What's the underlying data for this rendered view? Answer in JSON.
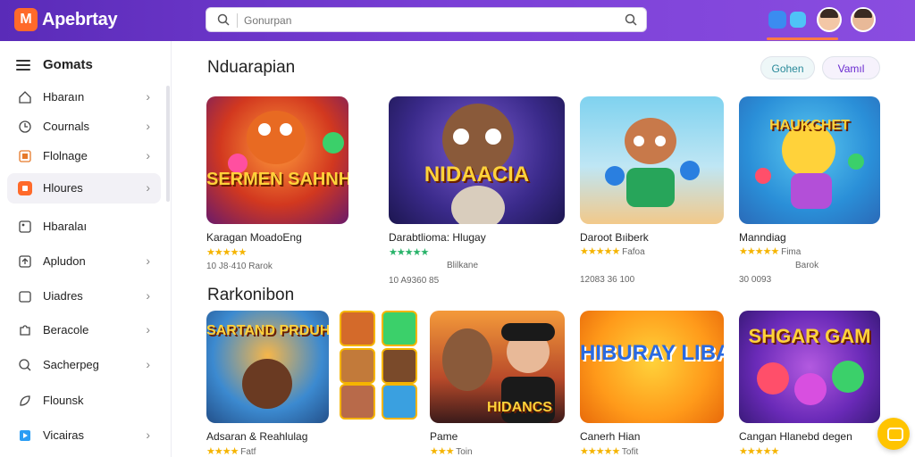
{
  "app": {
    "logo_letter": "M",
    "name": "Apebrtay"
  },
  "search": {
    "placeholder": "Gonurpan"
  },
  "sidebar": {
    "title": "Gomats",
    "items": [
      {
        "label": "Hbaraın",
        "icon": "home-icon"
      },
      {
        "label": "Cournals",
        "icon": "clock-icon"
      },
      {
        "label": "Flolnage",
        "icon": "grid-icon"
      },
      {
        "label": "Hloures",
        "icon": "star-icon",
        "active": true
      },
      {
        "label": "Hbaralaı",
        "icon": "image-icon"
      },
      {
        "label": "Apludon",
        "icon": "upload-icon"
      },
      {
        "label": "Uiadres",
        "icon": "folder-icon"
      },
      {
        "label": "Beracole",
        "icon": "puzzle-icon"
      },
      {
        "label": "Sacherpeg",
        "icon": "search-icon"
      },
      {
        "label": "Flounsk",
        "icon": "bookmark-icon"
      },
      {
        "label": "Vicairas",
        "icon": "video-icon"
      }
    ]
  },
  "main": {
    "section1_title": "Nduarapian",
    "section2_title": "Rarkonibon",
    "pills": {
      "left": "Gohen",
      "right": "Vamıl"
    },
    "row1": [
      {
        "img_text": "SERMEN SAHNHIIZ",
        "title": "Karagan MoadoEng",
        "stars": "★★★★★",
        "meta": "",
        "sub": "10 J8·410 Rarok"
      },
      {
        "img_text": "NIDAACIA",
        "title": "Darabtlioma: Hlugay",
        "stars": "★★★★★",
        "meta": "Blilkane",
        "sub": "10 A9360 85"
      },
      {
        "img_text": "",
        "title": "Daroot Bıiberk",
        "stars": "★★★★★",
        "meta": "Fafoa",
        "sub": "12083 36 100"
      },
      {
        "img_text": "HAUKCHET",
        "title": "Manndiag",
        "stars": "★★★★★",
        "meta": "Fima",
        "sub": "30 0093"
      }
    ],
    "row1_second_meta": [
      "",
      "",
      "",
      "Barok"
    ],
    "row2": [
      {
        "img_text": "SARTAND PRDUHEL",
        "title": "Adsaran & Reahlulag",
        "stars": "★★★★",
        "meta": "Fatf"
      },
      {
        "img_text": "HIDANCS",
        "title": "Pame",
        "stars": "★★★",
        "meta": "Toin"
      },
      {
        "img_text": "HIBURAY LIBASS",
        "title": "Canerh Hian",
        "stars": "★★★★★",
        "meta": "Tofit"
      },
      {
        "img_text": "SHGAR GAM",
        "title": "Cangan Hlanebd degen",
        "stars": "★★★★★",
        "meta": ""
      }
    ]
  },
  "colors": {
    "topbar": "#6a35c8",
    "accent": "#ff6a2a",
    "star": "#f5b400"
  }
}
